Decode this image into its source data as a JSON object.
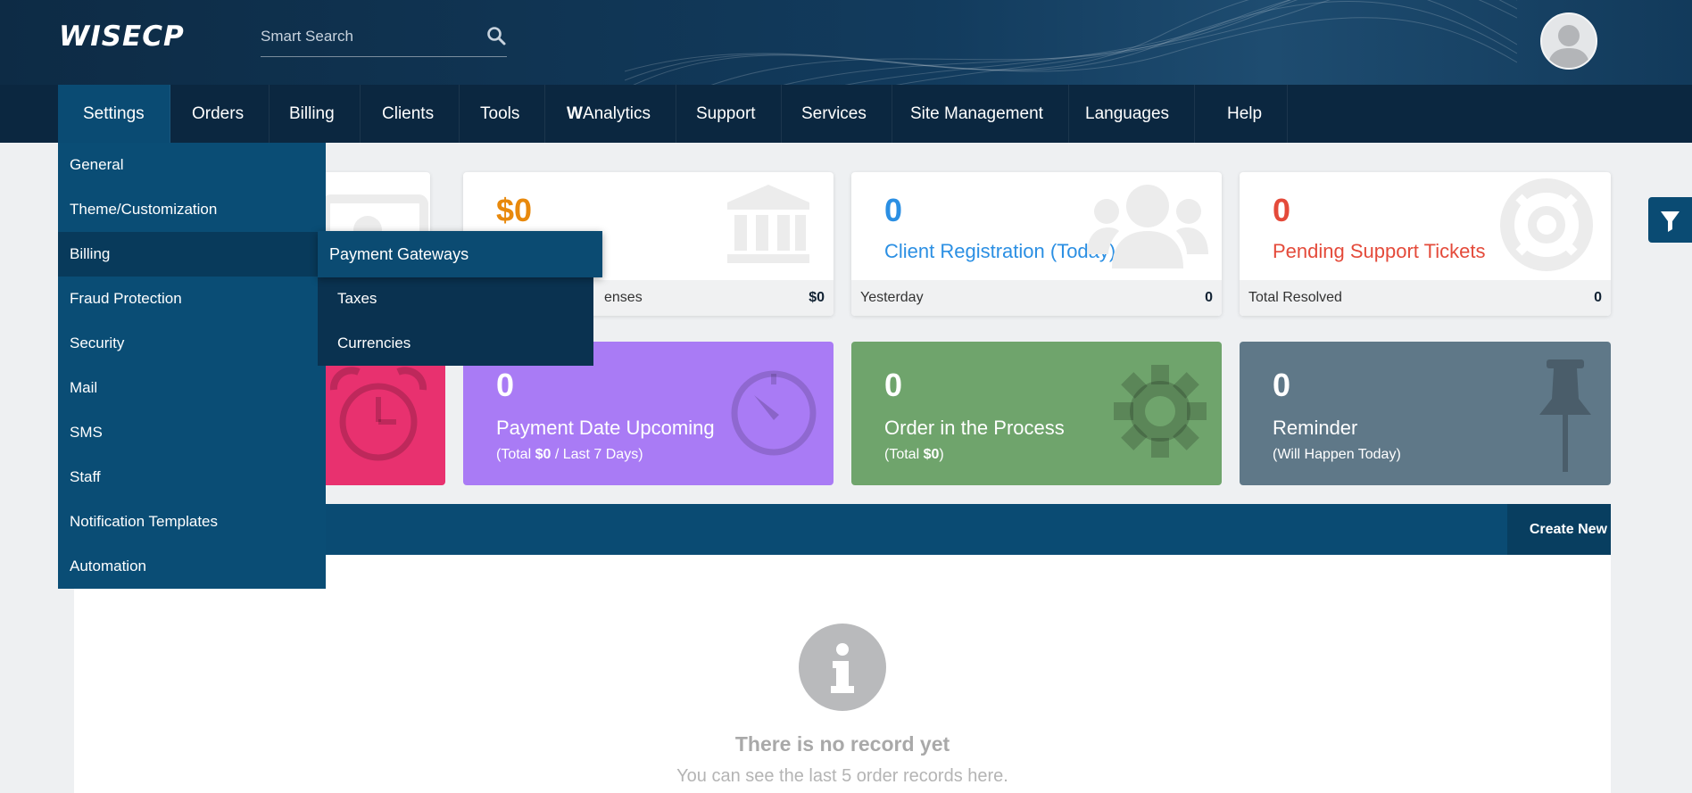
{
  "header": {
    "logo_text": "WISECP",
    "search_placeholder": "Smart Search"
  },
  "nav": {
    "items": [
      "Settings",
      "Orders",
      "Billing",
      "Clients",
      "Tools",
      "WAnalytics",
      "Support",
      "Services",
      "Site Management",
      "Languages",
      "Help"
    ],
    "active": "Settings"
  },
  "settings_menu": {
    "items": [
      "General",
      "Theme/Customization",
      "Billing",
      "Fraud Protection",
      "Security",
      "Mail",
      "SMS",
      "Staff",
      "Notification Templates",
      "Automation"
    ],
    "hovered": "Billing",
    "billing_submenu": [
      "Payment Gateways",
      "Taxes",
      "Currencies"
    ],
    "submenu_active": "Payment Gateways"
  },
  "cards": {
    "income": {
      "value": "$0",
      "foot_label": "enses",
      "foot_value": "$0"
    },
    "clients": {
      "value": "0",
      "label": "Client Registration (Today)",
      "foot_label": "Yesterday",
      "foot_value": "0"
    },
    "tickets": {
      "value": "0",
      "label": "Pending Support Tickets",
      "foot_label": "Total Resolved",
      "foot_value": "0"
    },
    "payment_upcoming": {
      "value": "0",
      "label": "Payment Date Upcoming",
      "sub_prefix": "(Total ",
      "sub_bold": "$0",
      "sub_suffix": " / Last 7 Days)"
    },
    "order_process": {
      "value": "0",
      "label": "Order in the Process",
      "sub_prefix": "(Total ",
      "sub_bold": "$0",
      "sub_suffix": ")"
    },
    "reminder": {
      "value": "0",
      "label": "Reminder",
      "sub": "(Will Happen Today)"
    }
  },
  "orders_panel": {
    "create_label": "Create New",
    "empty_title": "There is no record yet",
    "empty_sub": "You can see the last 5 order records here."
  },
  "colors": {
    "header_bg": "#0d2b45",
    "nav_bg": "#0b2740",
    "menu_bg": "#0a4d75",
    "accent_orange": "#e8890c",
    "accent_blue": "#2b8fe3",
    "accent_red": "#e44a3a",
    "pink": "#e8316f",
    "purple": "#a97bf5",
    "green": "#6fa46c",
    "slate": "#5f7888"
  }
}
